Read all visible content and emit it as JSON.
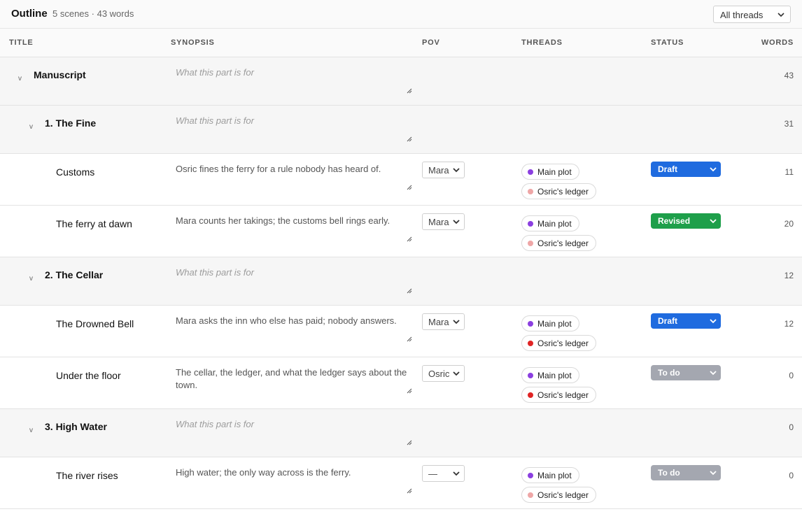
{
  "app": {
    "title": "Outline",
    "meta": "5 scenes · 43 words",
    "thread_filter": "All threads"
  },
  "columns": {
    "title": "TITLE",
    "synopsis": "SYNOPSIS",
    "pov": "POV",
    "threads": "THREADS",
    "status": "STATUS",
    "words": "WORDS"
  },
  "colors": {
    "main_plot": "#8b3fe0",
    "ledger_faded": "#eea6a6",
    "ledger_active": "#e02424",
    "draft": "#1f6bdf",
    "revised": "#1e9f4a",
    "todo": "#a4a7b0"
  },
  "rows": [
    {
      "kind": "part",
      "level": 0,
      "caret": "v",
      "title": "Manuscript",
      "synopsis_placeholder": "What this part is for",
      "words": "43"
    },
    {
      "kind": "part",
      "level": 1,
      "caret": "v",
      "title": "1. The Fine",
      "synopsis_placeholder": "What this part is for",
      "words": "31"
    },
    {
      "kind": "scene",
      "title": "Customs",
      "synopsis": "Osric fines the ferry for a rule nobody has heard of.",
      "pov": "Mara",
      "threads": [
        {
          "label": "Main plot",
          "color": "main_plot"
        },
        {
          "label": "Osric's ledger",
          "color": "ledger_faded"
        }
      ],
      "status": {
        "label": "Draft",
        "color": "draft"
      },
      "words": "11"
    },
    {
      "kind": "scene",
      "title": "The ferry at dawn",
      "synopsis": "Mara counts her takings; the customs bell rings early.",
      "pov": "Mara",
      "threads": [
        {
          "label": "Main plot",
          "color": "main_plot"
        },
        {
          "label": "Osric's ledger",
          "color": "ledger_faded"
        }
      ],
      "status": {
        "label": "Revised",
        "color": "revised"
      },
      "words": "20"
    },
    {
      "kind": "part",
      "level": 1,
      "caret": "v",
      "title": "2. The Cellar",
      "synopsis_placeholder": "What this part is for",
      "words": "12"
    },
    {
      "kind": "scene",
      "title": "The Drowned Bell",
      "synopsis": "Mara asks the inn who else has paid; nobody answers.",
      "pov": "Mara",
      "threads": [
        {
          "label": "Main plot",
          "color": "main_plot"
        },
        {
          "label": "Osric's ledger",
          "color": "ledger_active"
        }
      ],
      "status": {
        "label": "Draft",
        "color": "draft"
      },
      "words": "12"
    },
    {
      "kind": "scene",
      "title": "Under the floor",
      "synopsis": "The cellar, the ledger, and what the ledger says about the town.",
      "pov": "Osric",
      "threads": [
        {
          "label": "Main plot",
          "color": "main_plot"
        },
        {
          "label": "Osric's ledger",
          "color": "ledger_active"
        }
      ],
      "status": {
        "label": "To do",
        "color": "todo"
      },
      "words": "0"
    },
    {
      "kind": "part",
      "level": 1,
      "caret": "v",
      "title": "3. High Water",
      "synopsis_placeholder": "What this part is for",
      "words": "0"
    },
    {
      "kind": "scene",
      "title": "The river rises",
      "synopsis": "High water; the only way across is the ferry.",
      "pov": "—",
      "threads": [
        {
          "label": "Main plot",
          "color": "main_plot"
        },
        {
          "label": "Osric's ledger",
          "color": "ledger_faded"
        }
      ],
      "status": {
        "label": "To do",
        "color": "todo"
      },
      "words": "0"
    }
  ]
}
